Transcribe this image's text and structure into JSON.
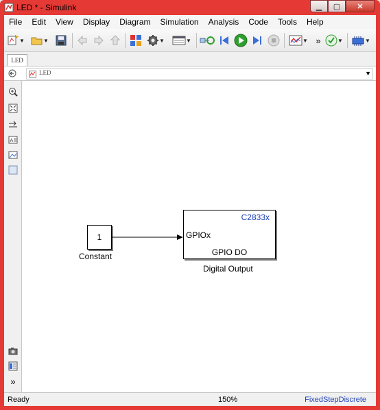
{
  "window": {
    "title": "LED * - Simulink"
  },
  "menubar": {
    "items": [
      "File",
      "Edit",
      "View",
      "Display",
      "Diagram",
      "Simulation",
      "Analysis",
      "Code",
      "Tools",
      "Help"
    ]
  },
  "toolbar": {
    "more_label": "»"
  },
  "tabs": [
    {
      "label": "LED"
    }
  ],
  "address": {
    "path": "LED"
  },
  "diagram": {
    "constant": {
      "value": "1",
      "name": "Constant"
    },
    "gpio": {
      "chip": "C2833x",
      "input_port": "GPIOx",
      "inner_label": "GPIO DO",
      "name": "Digital Output"
    }
  },
  "palette": {
    "more_label": "»"
  },
  "statusbar": {
    "status": "Ready",
    "zoom": "150%",
    "solver": "FixedStepDiscrete"
  },
  "colors": {
    "frame": "#e53935",
    "link_blue": "#1a3fb5",
    "run_green": "#2e9e2e"
  }
}
